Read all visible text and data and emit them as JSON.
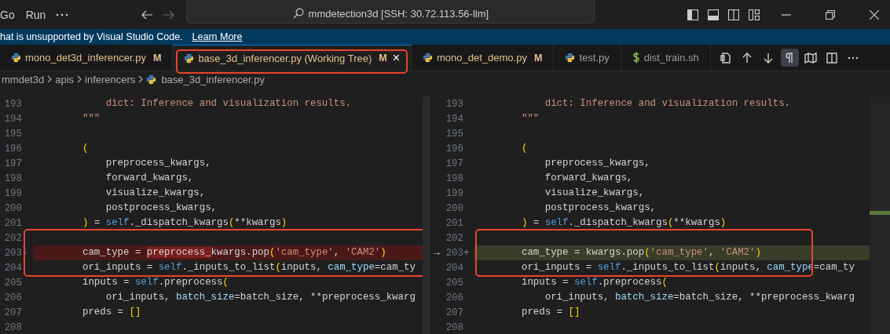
{
  "title_bar": {
    "menu": [
      "Go",
      "Run"
    ],
    "search": "mmdetection3d [SSH: 30.72.113.56-llm]"
  },
  "notification": {
    "message": "hat is unsupported by Visual Studio Code.",
    "link": "Learn More"
  },
  "tabs": [
    {
      "label": "mono_det3d_inferencer.py",
      "kind": "python",
      "badge": "M",
      "selected": false,
      "annotated": false
    },
    {
      "label": "base_3d_inferencer.py (Working Tree)",
      "kind": "python",
      "badge": "M",
      "selected": true,
      "close": "×",
      "annotated": true
    },
    {
      "label": "mono_det_demo.py",
      "kind": "python",
      "badge": "M",
      "selected": false,
      "annotated": false
    },
    {
      "label": "test.py",
      "kind": "python",
      "selected": false,
      "annotated": false
    },
    {
      "label": "dist_train.sh",
      "kind": "shell",
      "selected": false,
      "annotated": false
    }
  ],
  "editor_actions": [
    {
      "kind": "open-file",
      "on": false
    },
    {
      "kind": "up",
      "on": false
    },
    {
      "kind": "down",
      "on": false
    },
    {
      "kind": "whitespace",
      "on": true
    },
    {
      "kind": "map",
      "on": false
    },
    {
      "kind": "split",
      "on": false
    },
    {
      "kind": "more",
      "on": false
    }
  ],
  "breadcrumb": [
    {
      "label": "mmdet3d",
      "kind": "folder"
    },
    {
      "label": "apis",
      "kind": "folder"
    },
    {
      "label": "inferencers",
      "kind": "folder"
    },
    {
      "label": "base_3d_inferencer.py",
      "kind": "python"
    }
  ],
  "panes": [
    {
      "lines": [
        {
          "number": "193",
          "kind": "context",
          "annotated": false,
          "tokens": [
            {
              "kind": "doc",
              "t": "    dict: Inference and visualization results."
            }
          ]
        },
        {
          "number": "194",
          "kind": "context",
          "annotated": false,
          "tokens": [
            {
              "kind": "doc",
              "t": "\"\"\""
            }
          ]
        },
        {
          "number": "195",
          "kind": "context",
          "annotated": false
        },
        {
          "number": "196",
          "kind": "context",
          "annotated": false,
          "tokens": [
            {
              "kind": "bracket",
              "t": "("
            }
          ]
        },
        {
          "number": "197",
          "kind": "context",
          "annotated": false,
          "tokens": [
            {
              "kind": "plain",
              "t": "    preprocess_kwargs,"
            }
          ]
        },
        {
          "number": "198",
          "kind": "context",
          "annotated": false,
          "tokens": [
            {
              "kind": "plain",
              "t": "    forward_kwargs,"
            }
          ]
        },
        {
          "number": "199",
          "kind": "context",
          "annotated": false,
          "tokens": [
            {
              "kind": "plain",
              "t": "    visualize_kwargs,"
            }
          ]
        },
        {
          "number": "200",
          "kind": "context",
          "annotated": false,
          "tokens": [
            {
              "kind": "plain",
              "t": "    postprocess_kwargs,"
            }
          ]
        },
        {
          "number": "201",
          "kind": "context",
          "annotated": false,
          "tokens": [
            {
              "kind": "bracket",
              "t": ")"
            },
            {
              "kind": "plain",
              "t": " = "
            },
            {
              "kind": "self",
              "t": "self"
            },
            {
              "kind": "plain",
              "t": "._dispatch_kwargs"
            },
            {
              "kind": "bracket",
              "t": "("
            },
            {
              "kind": "plain",
              "t": "**kwargs"
            },
            {
              "kind": "bracket",
              "t": ")"
            }
          ]
        },
        {
          "number": "202",
          "kind": "context",
          "annotated": true
        },
        {
          "number": "203",
          "marker": "-",
          "kind": "removed",
          "annotated": true,
          "tokens": [
            {
              "kind": "plain",
              "t": "cam_type = "
            },
            {
              "kind": "plain",
              "t": "preprocess_",
              "changed": true
            },
            {
              "kind": "plain",
              "t": "kwargs.pop"
            },
            {
              "kind": "bracket",
              "t": "("
            },
            {
              "kind": "string",
              "t": "'cam_type'"
            },
            {
              "kind": "plain",
              "t": ", "
            },
            {
              "kind": "string",
              "t": "'CAM2'"
            },
            {
              "kind": "bracket",
              "t": ")"
            }
          ]
        },
        {
          "number": "204",
          "kind": "context",
          "annotated": true,
          "tokens": [
            {
              "kind": "plain",
              "t": "ori_inputs = "
            },
            {
              "kind": "self",
              "t": "self"
            },
            {
              "kind": "plain",
              "t": "._inputs_to_list"
            },
            {
              "kind": "bracket",
              "t": "("
            },
            {
              "kind": "plain",
              "t": "inputs, "
            },
            {
              "kind": "param",
              "t": "cam_type"
            },
            {
              "kind": "plain",
              "t": "=cam_ty"
            }
          ]
        },
        {
          "number": "205",
          "kind": "context",
          "annotated": false,
          "tokens": [
            {
              "kind": "plain",
              "t": "inputs = "
            },
            {
              "kind": "self",
              "t": "self"
            },
            {
              "kind": "plain",
              "t": ".preprocess"
            },
            {
              "kind": "bracket",
              "t": "("
            }
          ]
        },
        {
          "number": "206",
          "kind": "context",
          "annotated": false,
          "tokens": [
            {
              "kind": "plain",
              "t": "    ori_inputs, "
            },
            {
              "kind": "param",
              "t": "batch_size"
            },
            {
              "kind": "plain",
              "t": "=batch_size, **preprocess_kwarg"
            }
          ]
        },
        {
          "number": "207",
          "kind": "context",
          "annotated": false,
          "tokens": [
            {
              "kind": "plain",
              "t": "preds = "
            },
            {
              "kind": "bracket",
              "t": "[]"
            }
          ]
        },
        {
          "number": "208",
          "kind": "context",
          "annotated": false
        }
      ]
    },
    {
      "lines": [
        {
          "number": "193",
          "kind": "context",
          "annotated": false,
          "tokens": [
            {
              "kind": "doc",
              "t": "    dict: Inference and visualization results."
            }
          ]
        },
        {
          "number": "194",
          "kind": "context",
          "annotated": false,
          "tokens": [
            {
              "kind": "doc",
              "t": "\"\"\""
            }
          ]
        },
        {
          "number": "195",
          "kind": "context",
          "annotated": false
        },
        {
          "number": "196",
          "kind": "context",
          "annotated": false,
          "tokens": [
            {
              "kind": "bracket",
              "t": "("
            }
          ]
        },
        {
          "number": "197",
          "kind": "context",
          "annotated": false,
          "tokens": [
            {
              "kind": "plain",
              "t": "    preprocess_kwargs,"
            }
          ]
        },
        {
          "number": "198",
          "kind": "context",
          "annotated": false,
          "tokens": [
            {
              "kind": "plain",
              "t": "    forward_kwargs,"
            }
          ]
        },
        {
          "number": "199",
          "kind": "context",
          "annotated": false,
          "tokens": [
            {
              "kind": "plain",
              "t": "    visualize_kwargs,"
            }
          ]
        },
        {
          "number": "200",
          "kind": "context",
          "annotated": false,
          "tokens": [
            {
              "kind": "plain",
              "t": "    postprocess_kwargs,"
            }
          ]
        },
        {
          "number": "201",
          "kind": "context",
          "annotated": false,
          "tokens": [
            {
              "kind": "bracket",
              "t": ")"
            },
            {
              "kind": "plain",
              "t": " = "
            },
            {
              "kind": "self",
              "t": "self"
            },
            {
              "kind": "plain",
              "t": "._dispatch_kwargs"
            },
            {
              "kind": "bracket",
              "t": "("
            },
            {
              "kind": "plain",
              "t": "**kwargs"
            },
            {
              "kind": "bracket",
              "t": ")"
            }
          ]
        },
        {
          "number": "202",
          "kind": "context",
          "annotated": true
        },
        {
          "number": "203",
          "marker": "+",
          "action": "→",
          "kind": "added",
          "annotated": true,
          "tokens": [
            {
              "kind": "plain",
              "t": "cam_type = "
            },
            {
              "kind": "plain",
              "t": "kwargs.pop"
            },
            {
              "kind": "bracket",
              "t": "("
            },
            {
              "kind": "string",
              "t": "'cam_type'"
            },
            {
              "kind": "plain",
              "t": ", "
            },
            {
              "kind": "string",
              "t": "'CAM2'"
            },
            {
              "kind": "bracket",
              "t": ")"
            }
          ]
        },
        {
          "number": "204",
          "kind": "context",
          "annotated": true,
          "tokens": [
            {
              "kind": "plain",
              "t": "ori_inputs = "
            },
            {
              "kind": "self",
              "t": "self"
            },
            {
              "kind": "plain",
              "t": "._inputs_to_list"
            },
            {
              "kind": "bracket",
              "t": "("
            },
            {
              "kind": "plain",
              "t": "inputs, "
            },
            {
              "kind": "param",
              "t": "cam_type"
            },
            {
              "kind": "plain",
              "t": "=cam_ty"
            }
          ]
        },
        {
          "number": "205",
          "kind": "context",
          "annotated": false,
          "tokens": [
            {
              "kind": "plain",
              "t": "inputs = "
            },
            {
              "kind": "self",
              "t": "self"
            },
            {
              "kind": "plain",
              "t": ".preprocess"
            },
            {
              "kind": "bracket",
              "t": "("
            }
          ]
        },
        {
          "number": "206",
          "kind": "context",
          "annotated": false,
          "tokens": [
            {
              "kind": "plain",
              "t": "    ori_inputs, "
            },
            {
              "kind": "param",
              "t": "batch_size"
            },
            {
              "kind": "plain",
              "t": "=batch_size, **preprocess_kwarg"
            }
          ]
        },
        {
          "number": "207",
          "kind": "context",
          "annotated": false,
          "tokens": [
            {
              "kind": "plain",
              "t": "preds = "
            },
            {
              "kind": "bracket",
              "t": "[]"
            }
          ]
        },
        {
          "number": "208",
          "kind": "context",
          "annotated": false
        }
      ]
    }
  ]
}
